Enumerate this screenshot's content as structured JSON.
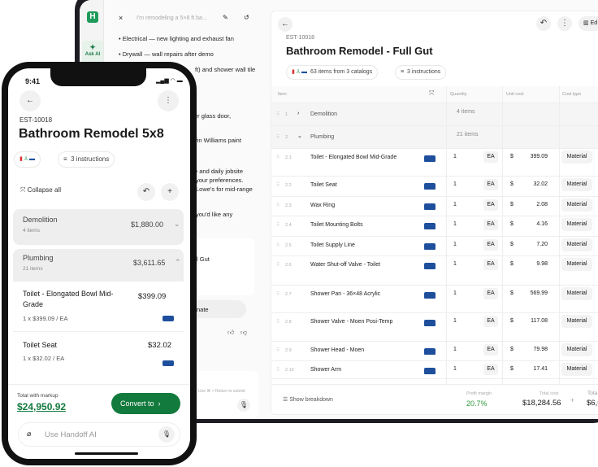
{
  "desktop": {
    "rail": {
      "ask_ai": "Ask AI"
    },
    "chat": {
      "title": "I'm remodeling a 5×8 ft ba...",
      "bullets": [
        "Electrical — new lighting and exhaust fan",
        "Drywall — wall repairs after demo"
      ],
      "fragments": [
        "ft) and shower wall tile",
        "er glass door,",
        "vin Williams paint",
        "e and daily jobsite",
        "your preferences.",
        "Lowe's for mid-range",
        "you'd like any"
      ],
      "card_fragment": "l Gut",
      "button_fragment": "nate",
      "input_hint": "Use ⌘ + Return to submit"
    },
    "estimate": {
      "id": "EST-10018",
      "title": "Bathroom Remodel - Full Gut",
      "catalogs": "63 items from 3 catalogs",
      "instructions": "3 instructions",
      "edit": "Ed",
      "columns": [
        "Item",
        "Quantity",
        "Unit cost",
        "Cost type"
      ],
      "groups": [
        {
          "num": "1",
          "name": "Demolition",
          "count": "4 items"
        },
        {
          "num": "2",
          "name": "Plumbing",
          "count": "21 items"
        }
      ],
      "items": [
        {
          "num": "2.1",
          "name": "Toilet - Elongated Bowl Mid-Grade",
          "qty": "1",
          "unit": "EA",
          "cost": "399.09",
          "type": "Material"
        },
        {
          "num": "2.2",
          "name": "Toilet Seat",
          "qty": "1",
          "unit": "EA",
          "cost": "32.02",
          "type": "Material"
        },
        {
          "num": "2.3",
          "name": "Wax Ring",
          "qty": "1",
          "unit": "EA",
          "cost": "2.08",
          "type": "Material"
        },
        {
          "num": "2.4",
          "name": "Toilet Mounting Bolts",
          "qty": "1",
          "unit": "EA",
          "cost": "4.16",
          "type": "Material"
        },
        {
          "num": "2.5",
          "name": "Toilet Supply Line",
          "qty": "1",
          "unit": "EA",
          "cost": "7.20",
          "type": "Material"
        },
        {
          "num": "2.6",
          "name": "Water Shut-off Valve - Toilet",
          "qty": "1",
          "unit": "EA",
          "cost": "9.98",
          "type": "Material"
        },
        {
          "num": "2.7",
          "name": "Shower Pan - 36×48 Acrylic",
          "qty": "1",
          "unit": "EA",
          "cost": "569.99",
          "type": "Material"
        },
        {
          "num": "2.8",
          "name": "Shower Valve - Moen Posi-Temp",
          "qty": "1",
          "unit": "EA",
          "cost": "117.08",
          "type": "Material"
        },
        {
          "num": "2.9",
          "name": "Shower Head - Moen",
          "qty": "1",
          "unit": "EA",
          "cost": "79.98",
          "type": "Material"
        },
        {
          "num": "2.10",
          "name": "Shower Arm",
          "qty": "1",
          "unit": "EA",
          "cost": "17.41",
          "type": "Material"
        }
      ],
      "currency": "$",
      "footer": {
        "breakdown": "Show breakdown",
        "margin_label": "Profit margin",
        "margin": "20.7%",
        "cost_label": "Total cost",
        "cost": "$18,284.56",
        "plus": "+",
        "total_label": "Tota",
        "total": "$6,6"
      }
    }
  },
  "phone": {
    "time": "9:41",
    "id": "EST-10018",
    "title": "Bathroom Remodel  5x8",
    "instructions": "3 instructions",
    "collapse": "Collapse all",
    "groups": [
      {
        "name": "Demolition",
        "count": "4 items",
        "total": "$1,880.00"
      },
      {
        "name": "Plumbing",
        "count": "21 items",
        "total": "$3,611.65"
      }
    ],
    "items": [
      {
        "name": "Toilet - Elongated Bowl Mid-Grade",
        "detail": "1 x $399.09 / EA",
        "price": "$399.09"
      },
      {
        "name": "Toilet Seat",
        "detail": "1 x $32.02 / EA",
        "price": "$32.02"
      }
    ],
    "total_label": "Total with markup",
    "total": "$24,950.92",
    "convert": "Convert to",
    "input_placeholder": "Use Handoff AI"
  },
  "colors": {
    "brand": "#1e9b5a",
    "button": "#137a3e",
    "lowes": "#1e4f9c"
  }
}
